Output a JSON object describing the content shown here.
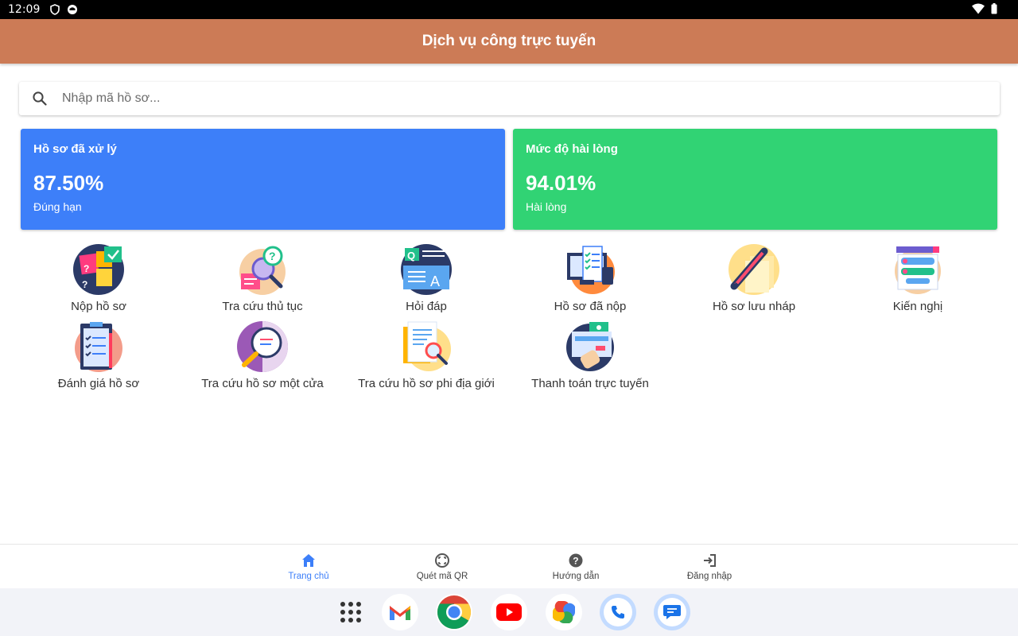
{
  "status_bar": {
    "time": "12:09"
  },
  "app_bar": {
    "title": "Dịch vụ công trực tuyến"
  },
  "search": {
    "placeholder": "Nhập mã hồ sơ..."
  },
  "stats": [
    {
      "title": "Hồ sơ đã xử lý",
      "value": "87.50%",
      "subtitle": "Đúng hạn",
      "color": "#3d7ff9"
    },
    {
      "title": "Mức độ hài lòng",
      "value": "94.01%",
      "subtitle": "Hài lòng",
      "color": "#31d374"
    }
  ],
  "features": [
    {
      "label": "Nộp hồ sơ",
      "icon": "submit-documents-icon"
    },
    {
      "label": "Tra cứu thủ tục",
      "icon": "procedure-search-icon"
    },
    {
      "label": "Hỏi đáp",
      "icon": "qa-icon"
    },
    {
      "label": "Hồ sơ đã nộp",
      "icon": "submitted-documents-icon"
    },
    {
      "label": "Hồ sơ lưu nháp",
      "icon": "draft-documents-icon"
    },
    {
      "label": "Kiến nghị",
      "icon": "petition-icon"
    },
    {
      "label": "Đánh giá hồ sơ",
      "icon": "evaluate-icon"
    },
    {
      "label": "Tra cứu hồ sơ một cửa",
      "icon": "one-stop-search-icon"
    },
    {
      "label": "Tra cứu hồ sơ phi địa giới",
      "icon": "non-territorial-search-icon"
    },
    {
      "label": "Thanh toán trực tuyến",
      "icon": "online-payment-icon"
    }
  ],
  "bottom_nav": [
    {
      "label": "Trang chủ",
      "icon": "home-icon",
      "active": true
    },
    {
      "label": "Quét mã QR",
      "icon": "qr-scan-icon",
      "active": false
    },
    {
      "label": "Hướng dẫn",
      "icon": "help-icon",
      "active": false
    },
    {
      "label": "Đăng nhập",
      "icon": "login-icon",
      "active": false
    }
  ],
  "colors": {
    "app_bar": "#cc7b56",
    "accent": "#3d7ff9",
    "green": "#31d374"
  }
}
